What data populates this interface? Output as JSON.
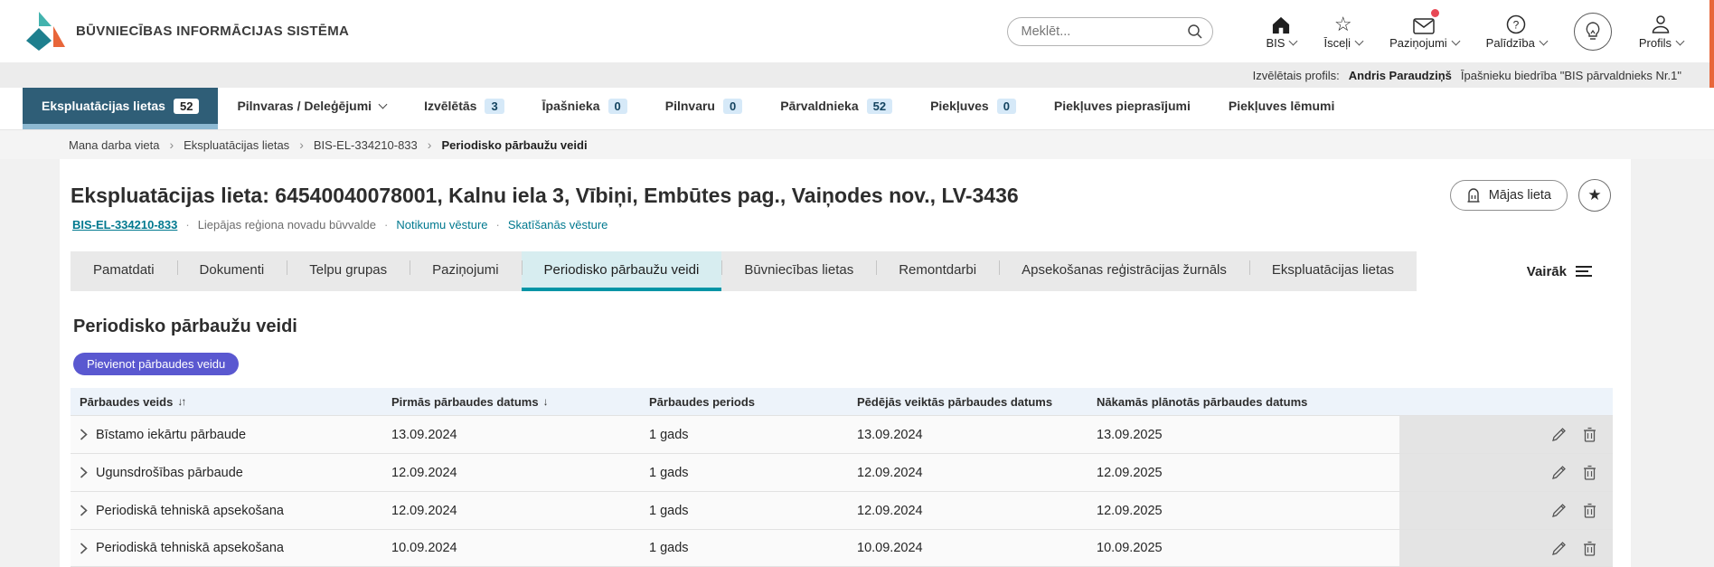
{
  "brand": {
    "title": "BŪVNIECĪBAS INFORMĀCIJAS SISTĒMA"
  },
  "header": {
    "search_placeholder": "Meklēt...",
    "menus": [
      {
        "label": "BIS",
        "icon": "home-icon"
      },
      {
        "label": "Īsceļi",
        "icon": "star-icon"
      },
      {
        "label": "Paziņojumi",
        "icon": "mail-icon",
        "notification": true
      },
      {
        "label": "Palīdzība",
        "icon": "help-icon"
      },
      {
        "label": "Profils",
        "icon": "user-icon"
      }
    ]
  },
  "profile_bar": {
    "label": "Izvēlētais profils:",
    "name": "Andris Paraudziņš",
    "org": "Īpašnieku biedrība \"BIS pārvaldnieks Nr.1\""
  },
  "nav": {
    "items": [
      {
        "label": "Ekspluatācijas lietas",
        "badge": "52",
        "active": true
      },
      {
        "label": "Pilnvaras / Deleģējumi",
        "chevron": true
      },
      {
        "label": "Izvēlētās",
        "badge": "3"
      },
      {
        "label": "Īpašnieka",
        "badge": "0"
      },
      {
        "label": "Pilnvaru",
        "badge": "0"
      },
      {
        "label": "Pārvaldnieka",
        "badge": "52"
      },
      {
        "label": "Piekļuves",
        "badge": "0"
      },
      {
        "label": "Piekļuves pieprasījumi"
      },
      {
        "label": "Piekļuves lēmumi"
      }
    ]
  },
  "breadcrumb": {
    "items": [
      "Mana darba vieta",
      "Ekspluatācijas lietas",
      "BIS-EL-334210-833",
      "Periodisko pārbaužu veidi"
    ]
  },
  "case": {
    "title": "Ekspluatācijas lieta: 64540040078001, Kalnu iela 3, Vībiņi, Embūtes pag., Vaiņodes nov., LV-3436",
    "number_link": "BIS-EL-334210-833",
    "authority": "Liepājas reģiona novadu būvvalde",
    "history_link": "Notikumu vēsture",
    "views_link": "Skatīšanās vēsture",
    "home_button": "Mājas lieta"
  },
  "tabs": {
    "items": [
      {
        "label": "Pamatdati"
      },
      {
        "label": "Dokumenti"
      },
      {
        "label": "Telpu grupas"
      },
      {
        "label": "Paziņojumi"
      },
      {
        "label": "Periodisko pārbaužu veidi",
        "active": true
      },
      {
        "label": "Būvniecības lietas"
      },
      {
        "label": "Remontdarbi"
      },
      {
        "label": "Apsekošanas reģistrācijas žurnāls"
      },
      {
        "label": "Ekspluatācijas lietas"
      }
    ],
    "more_label": "Vairāk"
  },
  "section": {
    "title": "Periodisko pārbaužu veidi",
    "add_button": "Pievienot pārbaudes veidu"
  },
  "table": {
    "columns": [
      {
        "label": "Pārbaudes veids",
        "sort": "both"
      },
      {
        "label": "Pirmās pārbaudes datums",
        "sort": "desc"
      },
      {
        "label": "Pārbaudes periods"
      },
      {
        "label": "Pēdējās veiktās pārbaudes datums"
      },
      {
        "label": "Nākamās plānotās pārbaudes datums"
      }
    ],
    "rows": [
      {
        "type": "Bīstamo iekārtu pārbaude",
        "first_date": "13.09.2024",
        "period": "1 gads",
        "last_date": "13.09.2024",
        "next_date": "13.09.2025"
      },
      {
        "type": "Ugunsdrošības pārbaude",
        "first_date": "12.09.2024",
        "period": "1 gads",
        "last_date": "12.09.2024",
        "next_date": "12.09.2025"
      },
      {
        "type": "Periodiskā tehniskā apsekošana",
        "first_date": "12.09.2024",
        "period": "1 gads",
        "last_date": "12.09.2024",
        "next_date": "12.09.2025"
      },
      {
        "type": "Periodiskā tehniskā apsekošana",
        "first_date": "10.09.2024",
        "period": "1 gads",
        "last_date": "10.09.2024",
        "next_date": "10.09.2025"
      }
    ]
  },
  "colors": {
    "nav_active_bg": "#2f5e77",
    "nav_active_underline": "#8db9d2",
    "badge_bg": "#d6e9f8",
    "tab_active_bg": "#d7edf0",
    "tab_active_underline": "#0095a6",
    "link_teal": "#00798f",
    "add_button_purple": "#5a58d0",
    "table_header_bg": "#edf3fa",
    "actions_col_bg": "#e4e4e4",
    "notification_red": "#e84855",
    "logo_teal": "#43b3ae",
    "logo_dark_teal": "#1e7f8e",
    "logo_orange": "#e8663a"
  }
}
